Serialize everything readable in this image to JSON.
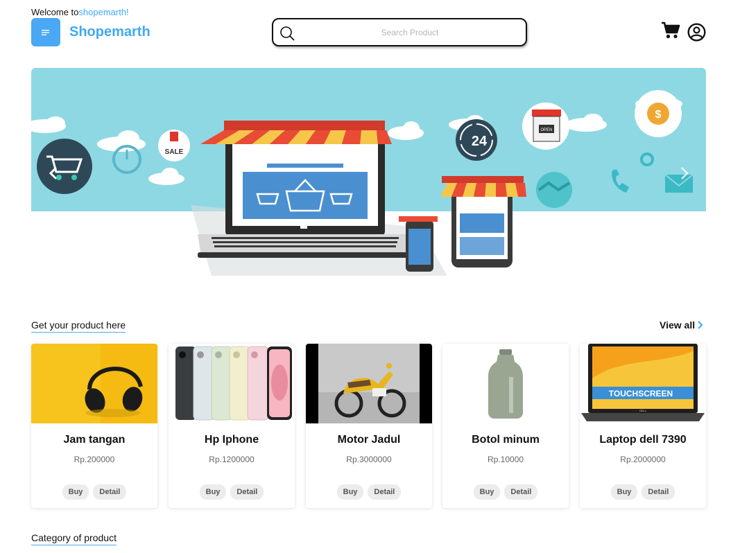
{
  "header": {
    "welcome_prefix": "Welcome to",
    "welcome_brand": "shopemarth!",
    "brand": "Shopemarth",
    "search_placeholder": "Search Product",
    "search_value": ""
  },
  "banner": {
    "sale_label": "SALE",
    "support_label": "24",
    "shop_sign": "OPEN",
    "currency_symbol": "$"
  },
  "products_section": {
    "title": "Get your product here",
    "view_all_label": "View all",
    "buy_label": "Buy",
    "detail_label": "Detail",
    "items": [
      {
        "name": "Jam tangan",
        "price": "Rp.200000",
        "image": "headphones"
      },
      {
        "name": "Hp Iphone",
        "price": "Rp.1200000",
        "image": "iphones"
      },
      {
        "name": "Motor Jadul",
        "price": "Rp.3000000",
        "image": "motorbike"
      },
      {
        "name": "Botol minum",
        "price": "Rp.10000",
        "image": "bottle"
      },
      {
        "name": "Laptop dell 7390",
        "price": "Rp.2000000",
        "image": "laptop",
        "image_text": "TOUCHSCREEN",
        "image_brand": "DELL"
      }
    ]
  },
  "category_section": {
    "title": "Category of product"
  },
  "colors": {
    "accent": "#3fa9f5",
    "banner_sky": "#8ed8e3",
    "pill_bg": "#ececec"
  }
}
